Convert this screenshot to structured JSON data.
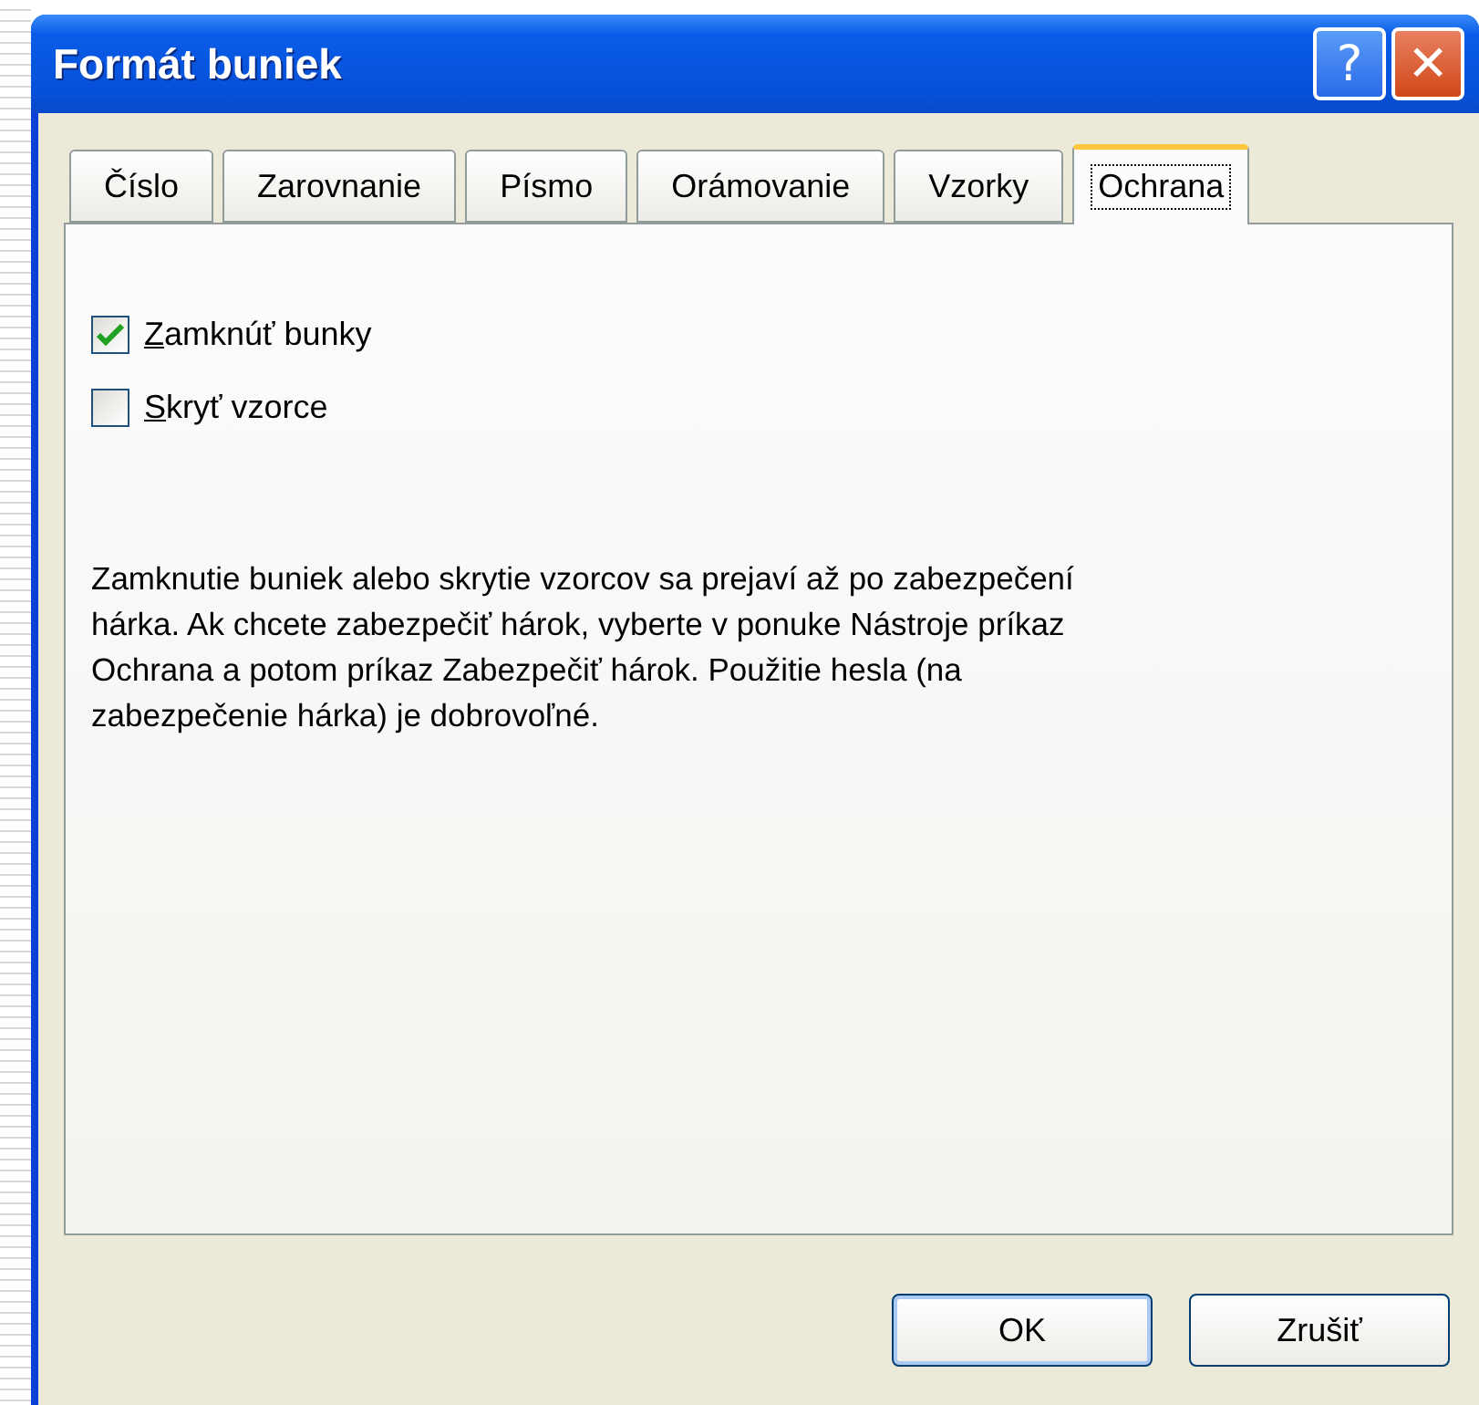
{
  "window": {
    "title": "Formát buniek",
    "help_button": "?",
    "close_button": "✕"
  },
  "tabs": [
    {
      "label": "Číslo",
      "selected": false
    },
    {
      "label": "Zarovnanie",
      "selected": false
    },
    {
      "label": "Písmo",
      "selected": false
    },
    {
      "label": "Orámovanie",
      "selected": false
    },
    {
      "label": "Vzorky",
      "selected": false
    },
    {
      "label": "Ochrana",
      "selected": true
    }
  ],
  "options": [
    {
      "label": "Zamknúť bunky",
      "checked": true
    },
    {
      "label": "Skryť vzorce",
      "checked": false
    }
  ],
  "note": "Zamknutie buniek alebo skrytie vzorcov sa prejaví až po zabezpečení hárka. Ak chcete zabezpečiť hárok, vyberte v ponuke Nástroje príkaz Ochrana a potom príkaz Zabezpečiť hárok. Použitie hesla (na zabezpečenie hárka) je dobrovoľné.",
  "buttons": [
    {
      "label": "OK",
      "default": true
    },
    {
      "label": "Zrušiť",
      "default": false
    }
  ]
}
